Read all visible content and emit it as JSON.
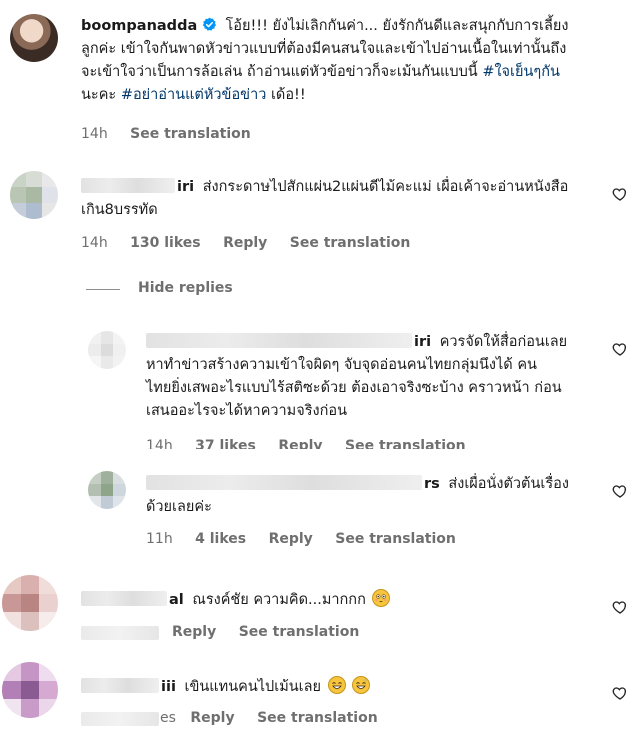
{
  "post": {
    "username": "boompanadda",
    "caption_lines": [
      "โอ้ย!!! ยังไม่เลิกกันค่า... ยังรักกันดีและสนุกกับการเลี้ยง",
      "ลูกค่ะ เข้าใจกันพาดหัวข่าวแบบที่ต้องมีคนสนใจและเข้าไปอ่านเนื้อในเท่านั้นถึง",
      "จะเข้าใจว่าเป็นการล้อเล่น ถ้าอ่านแต่หัวข้อข่าวก็จะเม้นกันแบบนี้",
      "นะคะ",
      "เด้อ!!"
    ],
    "hashtag1": "#ใจเย็นๆกัน",
    "hashtag2": "#อย่าอ่านแต่หัวข้อข่าว",
    "time": "14h",
    "see_translation": "See translation"
  },
  "comments": [
    {
      "name_suffix": "iri",
      "text_lines": [
        "ส่งกระดาษไปสักแผ่น2แผ่นดีไม้คะแม่ เผื่อเค้าจะอ่านหนังสือ",
        "เกิน8บรรทัด"
      ],
      "time": "14h",
      "likes": "130 likes",
      "reply": "Reply",
      "see_translation": "See translation",
      "colors": [
        "#c9d3c6",
        "#d7ddd4",
        "#e8e8ea",
        "#b8c6b3",
        "#a9b9a3",
        "#dfe3e9",
        "#c5cddb",
        "#aebccf",
        "#e6e6e6"
      ]
    }
  ],
  "hide_replies": "Hide replies",
  "replies": [
    {
      "name_suffix": "iri",
      "text_lines": [
        "ควรจัดให้สื่อก่อนเลย",
        "หาทำข่าวสร้างความเข้าใจผิดๆ จับจุดอ่อนคนไทยกลุ่มนึงได้ คน",
        "ไทยยิ่งเสพอะไรแบบไร้สติซะด้วย ต้องเอาจริงซะบ้าง คราวหน้า ก่อน",
        "เสนออะไรจะได้หาความจริงก่อน"
      ],
      "time": "14h",
      "likes": "37 likes",
      "reply": "Reply",
      "see_translation": "See translation",
      "colors": [
        "#f1f1f1",
        "#e6e6e6",
        "#f3f3f3",
        "#ececec",
        "#dcdcdc",
        "#f0f0f0",
        "#f5f5f5",
        "#e9e9e9",
        "#f2f2f2"
      ]
    },
    {
      "name_suffix": "rs",
      "text_lines": [
        "ส่งเผื่อนั่งตัวต้นเรื่อง",
        "ด้วยเลยค่ะ"
      ],
      "time": "11h",
      "likes": "4 likes",
      "reply": "Reply",
      "see_translation": "See translation",
      "colors": [
        "#c6cfc4",
        "#9fb19c",
        "#d9dfe0",
        "#b3bfb0",
        "#8ea58a",
        "#cdd7dd",
        "#e3e6e8",
        "#c0cbd6",
        "#dfe4ea"
      ]
    }
  ],
  "comments_bottom": [
    {
      "name_suffix": "al",
      "text": "ณรงค์ชัย ความคิด...มากกก",
      "reply": "Reply",
      "see_translation": "See translation",
      "colors": [
        "#e7c9c4",
        "#d9b0ae",
        "#f0dcd8",
        "#c99896",
        "#b98583",
        "#ead0cf",
        "#f2e2df",
        "#dcc0bd",
        "#f5eceb"
      ]
    },
    {
      "name_suffix": "iii",
      "text": "เขินแทนคนไปเม้นเลย",
      "likes_suffix": "es",
      "reply": "Reply",
      "see_translation": "See translation",
      "colors": [
        "#e5c9e3",
        "#c596c5",
        "#eedcef",
        "#b27fb6",
        "#8a5a93",
        "#d6a9d2",
        "#f1e4f1",
        "#c99bc9",
        "#ecd6ea"
      ]
    }
  ],
  "colors": {
    "verified": "#0095f6",
    "hashtag": "#00376b",
    "meta": "#6f6f6f"
  }
}
